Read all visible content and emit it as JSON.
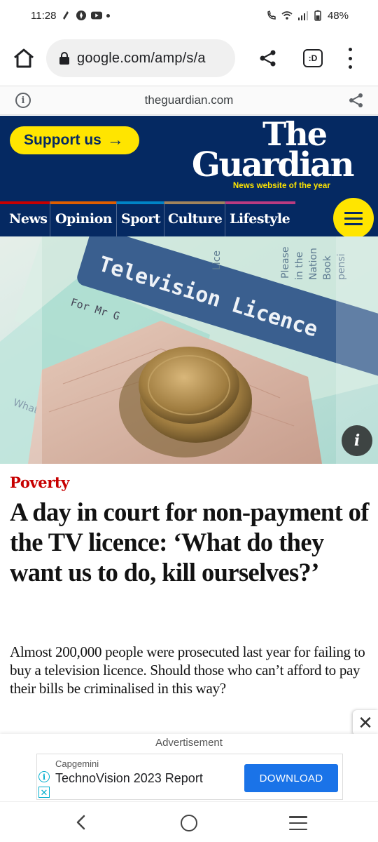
{
  "status_bar": {
    "time": "11:28",
    "battery": "48%"
  },
  "browser": {
    "url": "google.com/amp/s/a",
    "tabs_icon_label": ":D",
    "icons": [
      "home-icon",
      "lock-icon",
      "share-icon",
      "tabs-icon",
      "more-vert-icon"
    ]
  },
  "amp_bar": {
    "domain": "theguardian.com",
    "info_glyph": "i"
  },
  "header": {
    "support_label": "Support us",
    "support_arrow": "→",
    "logo_line1": "The",
    "logo_line2": "Guardian",
    "tagline": "News website of the year",
    "colors": {
      "brand_blue": "#052962",
      "yellow": "#ffe500"
    }
  },
  "nav": {
    "items": [
      {
        "label": "News",
        "color": "#c70000"
      },
      {
        "label": "Opinion",
        "color": "#e05e00"
      },
      {
        "label": "Sport",
        "color": "#0084c6"
      },
      {
        "label": "Culture",
        "color": "#a1845c"
      },
      {
        "label": "Lifestyle",
        "color": "#bb3b80"
      }
    ]
  },
  "hero": {
    "licence_text": "Television Licence",
    "info_glyph": "i"
  },
  "article": {
    "kicker": "Poverty",
    "headline": "A day in court for non-payment of the TV licence: ‘What do they want us to do, kill ourselves?’",
    "standfirst": "Almost 200,000 people were prosecuted last year for failing to buy a television licence. Should those who can’t afford to pay their bills be criminalised in this way?",
    "kicker_color": "#c70000"
  },
  "ad": {
    "label": "Advertisement",
    "brand": "Capgemini",
    "title": "TechnoVision 2023 Report",
    "button": "DOWNLOAD",
    "close_glyph": "✕",
    "info_glyph": "i",
    "x_glyph": "✕"
  }
}
